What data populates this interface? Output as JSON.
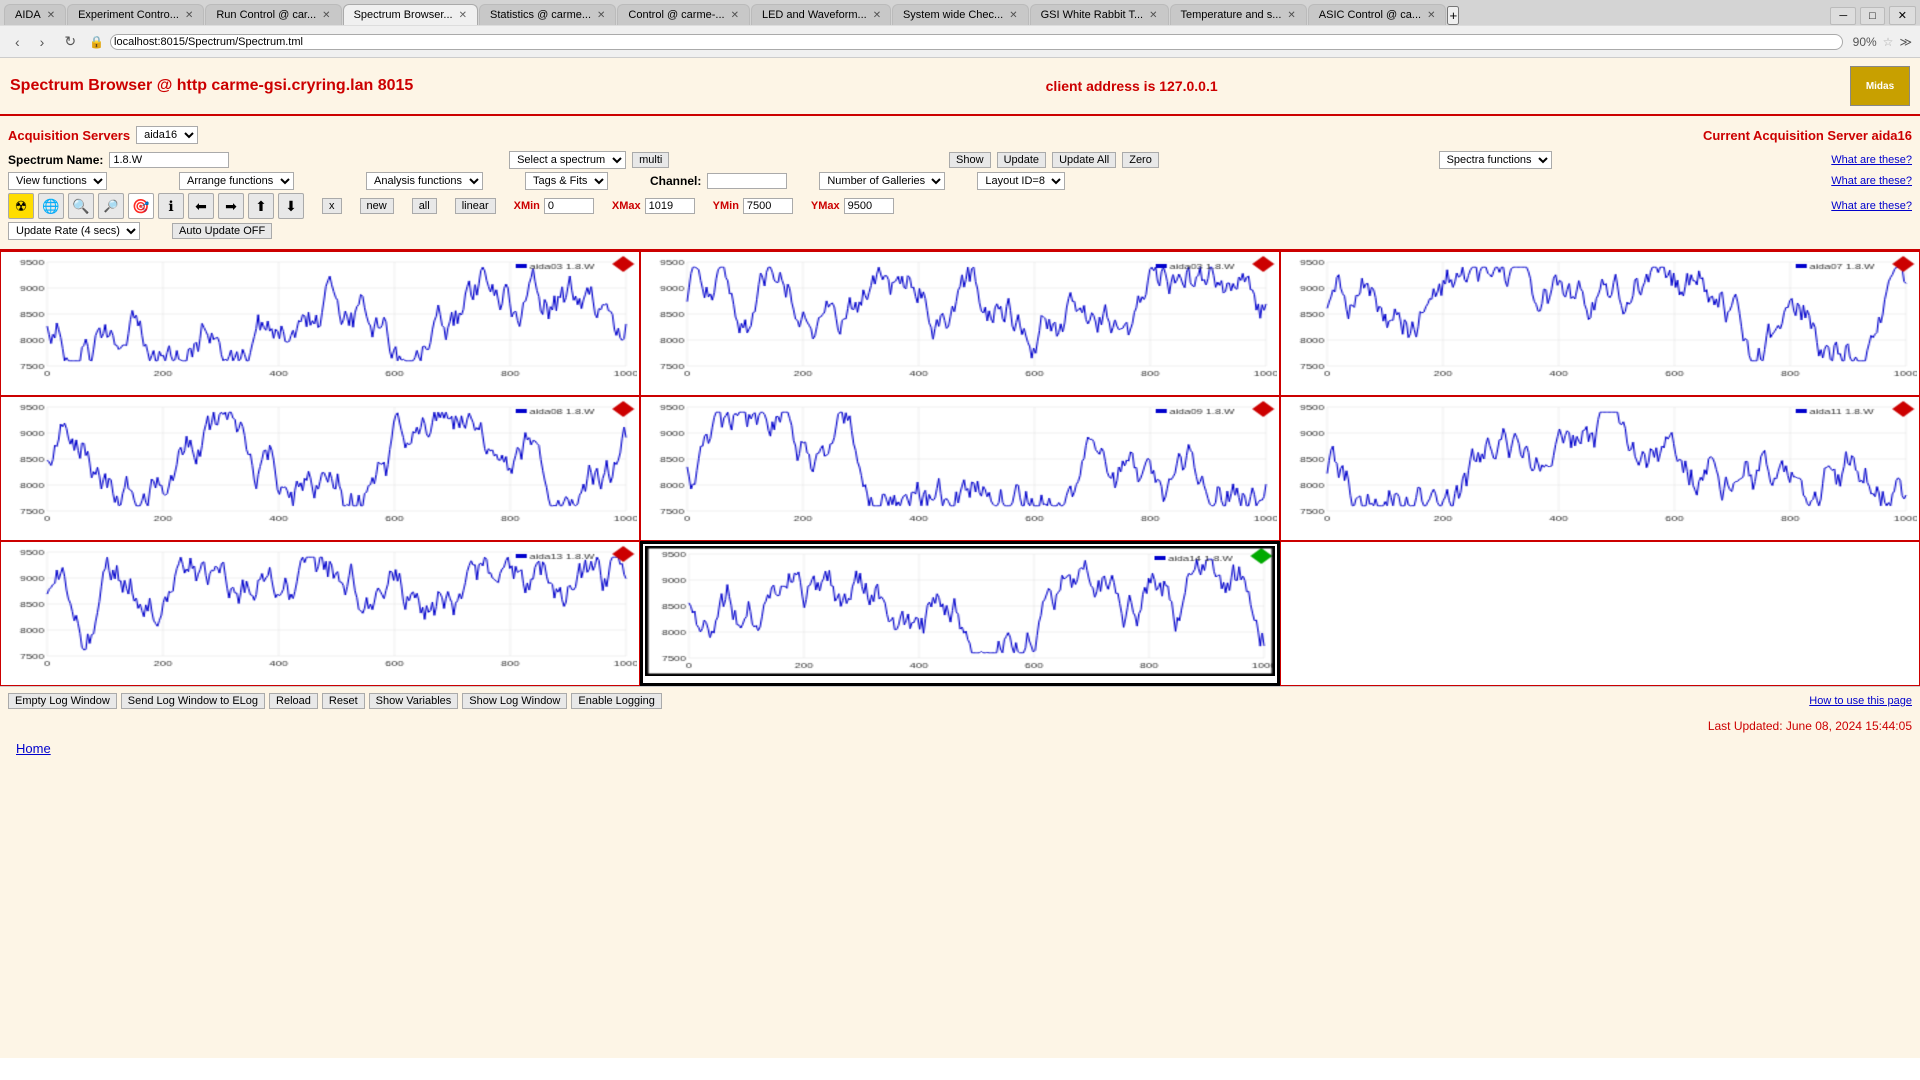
{
  "browser": {
    "url": "localhost:8015/Spectrum/Spectrum.tml",
    "zoom": "90%",
    "tabs": [
      {
        "label": "AIDA",
        "active": false
      },
      {
        "label": "Experiment Contro...",
        "active": false
      },
      {
        "label": "Run Control @ car...",
        "active": false
      },
      {
        "label": "Spectrum Browser...",
        "active": true
      },
      {
        "label": "Statistics @ carme...",
        "active": false
      },
      {
        "label": "Control @ carme-...",
        "active": false
      },
      {
        "label": "LED and Waveform...",
        "active": false
      },
      {
        "label": "System wide Chec...",
        "active": false
      },
      {
        "label": "GSI White Rabbit T...",
        "active": false
      },
      {
        "label": "Temperature and s...",
        "active": false
      },
      {
        "label": "ASIC Control @ ca...",
        "active": false
      }
    ]
  },
  "header": {
    "title": "Spectrum Browser @ http carme-gsi.cryring.lan 8015",
    "client_address_label": "client address is 127.0.0.1"
  },
  "acquisition": {
    "servers_label": "Acquisition Servers",
    "servers_value": "aida16",
    "current_label": "Current Acquisition Server aida16"
  },
  "controls": {
    "spectrum_name_label": "Spectrum Name:",
    "spectrum_name_value": "1.8.W",
    "select_spectrum_label": "Select a spectrum",
    "multi_label": "multi",
    "show_label": "Show",
    "update_label": "Update",
    "update_all_label": "Update All",
    "zero_label": "Zero",
    "spectra_functions_label": "Spectra functions",
    "what_are_these_1": "What are these?",
    "view_functions_label": "View functions",
    "arrange_functions_label": "Arrange functions",
    "analysis_functions_label": "Analysis functions",
    "tags_fits_label": "Tags & Fits",
    "channel_label": "Channel:",
    "channel_value": "",
    "number_galleries_label": "Number of Galleries",
    "layout_id_label": "Layout ID=8",
    "what_are_these_2": "What are these?",
    "x_btn": "x",
    "new_btn": "new",
    "all_btn": "all",
    "linear_btn": "linear",
    "xmin_label": "XMin",
    "xmin_value": "0",
    "xmax_label": "XMax",
    "xmax_value": "1019",
    "ymin_label": "YMin",
    "ymin_value": "7500",
    "ymax_label": "YMax",
    "ymax_value": "9500",
    "what_are_these_3": "What are these?",
    "update_rate_label": "Update Rate (4 secs)",
    "auto_update_label": "Auto Update OFF"
  },
  "charts": [
    {
      "id": "aida03",
      "label": "aida03 1.8.W",
      "corner": "red",
      "ymin": 7500,
      "ymax": 9500,
      "xmax": 1000,
      "row": 0,
      "col": 0
    },
    {
      "id": "aida03b",
      "label": "aida03 1.8.W",
      "corner": "red",
      "ymin": 7500,
      "ymax": 9500,
      "xmax": 1000,
      "row": 0,
      "col": 1
    },
    {
      "id": "aida07",
      "label": "aida07 1.8.W",
      "corner": "red",
      "ymin": 7500,
      "ymax": 9500,
      "xmax": 1000,
      "row": 0,
      "col": 2
    },
    {
      "id": "aida08",
      "label": "aida08 1.8.W",
      "corner": "red",
      "ymin": 7500,
      "ymax": 9500,
      "xmax": 1000,
      "row": 1,
      "col": 0
    },
    {
      "id": "aida09",
      "label": "aida09 1.8.W",
      "corner": "red",
      "ymin": 7500,
      "ymax": 9500,
      "xmax": 1000,
      "row": 1,
      "col": 1
    },
    {
      "id": "aida11",
      "label": "aida11 1.8.W",
      "corner": "red",
      "ymin": 7500,
      "ymax": 9500,
      "xmax": 1000,
      "row": 1,
      "col": 2
    },
    {
      "id": "aida13",
      "label": "aida13 1.8.W",
      "corner": "red",
      "ymin": 7500,
      "ymax": 9500,
      "xmax": 1000,
      "row": 2,
      "col": 0
    },
    {
      "id": "aida14",
      "label": "aida14 1.8.W",
      "corner": "green",
      "ymin": 7500,
      "ymax": 9500,
      "xmax": 1000,
      "row": 2,
      "col": 1,
      "selected": true
    },
    {
      "id": "empty",
      "label": "",
      "corner": "none",
      "ymin": 7500,
      "ymax": 9500,
      "xmax": 1000,
      "row": 2,
      "col": 2
    }
  ],
  "bottom_buttons": [
    {
      "label": "Empty Log Window",
      "id": "empty-log"
    },
    {
      "label": "Send Log Window to ELog",
      "id": "send-log"
    },
    {
      "label": "Reload",
      "id": "reload"
    },
    {
      "label": "Reset",
      "id": "reset"
    },
    {
      "label": "Show Variables",
      "id": "show-vars"
    },
    {
      "label": "Show Log Window",
      "id": "show-log"
    },
    {
      "label": "Enable Logging",
      "id": "enable-logging"
    }
  ],
  "footer": {
    "how_to": "How to use this page",
    "last_updated": "Last Updated: June 08, 2024 15:44:05",
    "home_label": "Home"
  }
}
